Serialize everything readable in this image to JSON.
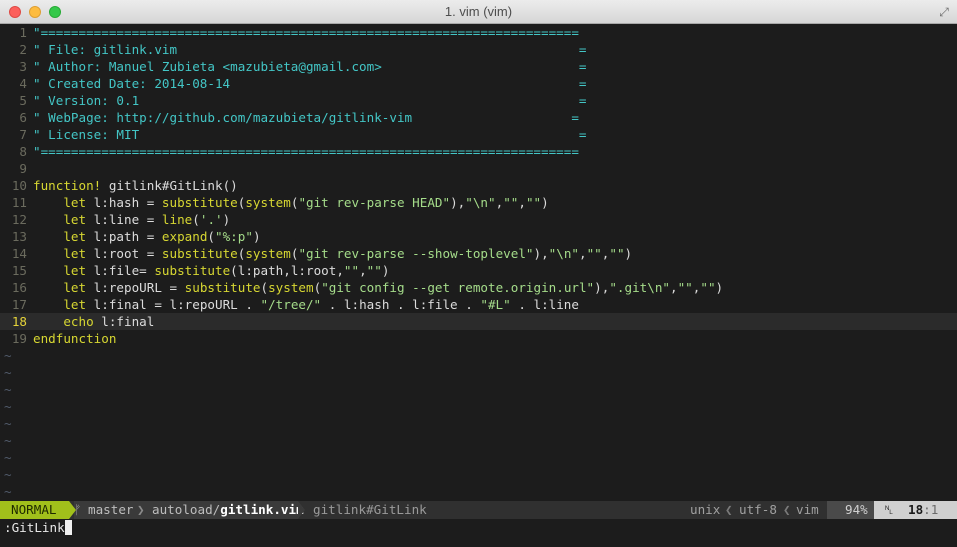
{
  "window": {
    "title": "1. vim (vim)"
  },
  "lines": [
    {
      "num": "1",
      "tokens": [
        {
          "t": "c",
          "v": "\"======================================================================="
        }
      ]
    },
    {
      "num": "2",
      "tokens": [
        {
          "t": "c",
          "v": "\" File: gitlink.vim                                                     ="
        }
      ]
    },
    {
      "num": "3",
      "tokens": [
        {
          "t": "c",
          "v": "\" Author: Manuel Zubieta <mazubieta@gmail.com>                          ="
        }
      ]
    },
    {
      "num": "4",
      "tokens": [
        {
          "t": "c",
          "v": "\" Created Date: 2014-08-14                                              ="
        }
      ]
    },
    {
      "num": "5",
      "tokens": [
        {
          "t": "c",
          "v": "\" Version: 0.1                                                          ="
        }
      ]
    },
    {
      "num": "6",
      "tokens": [
        {
          "t": "c",
          "v": "\" WebPage: http://github.com/mazubieta/gitlink-vim                     ="
        }
      ]
    },
    {
      "num": "7",
      "tokens": [
        {
          "t": "c",
          "v": "\" License: MIT                                                          ="
        }
      ]
    },
    {
      "num": "8",
      "tokens": [
        {
          "t": "c",
          "v": "\"======================================================================="
        }
      ]
    },
    {
      "num": "9",
      "tokens": []
    },
    {
      "num": "10",
      "tokens": [
        {
          "t": "k",
          "v": "function!"
        },
        {
          "t": "n",
          "v": " gitlink#GitLink()"
        }
      ]
    },
    {
      "num": "11",
      "tokens": [
        {
          "t": "n",
          "v": "    "
        },
        {
          "t": "k",
          "v": "let"
        },
        {
          "t": "n",
          "v": " l:hash = "
        },
        {
          "t": "k",
          "v": "substitute"
        },
        {
          "t": "n",
          "v": "("
        },
        {
          "t": "k",
          "v": "system"
        },
        {
          "t": "n",
          "v": "("
        },
        {
          "t": "s",
          "v": "\"git rev-parse HEAD\""
        },
        {
          "t": "n",
          "v": "),"
        },
        {
          "t": "s",
          "v": "\"\\n\""
        },
        {
          "t": "n",
          "v": ","
        },
        {
          "t": "s",
          "v": "\"\""
        },
        {
          "t": "n",
          "v": ","
        },
        {
          "t": "s",
          "v": "\"\""
        },
        {
          "t": "n",
          "v": ")"
        }
      ]
    },
    {
      "num": "12",
      "tokens": [
        {
          "t": "n",
          "v": "    "
        },
        {
          "t": "k",
          "v": "let"
        },
        {
          "t": "n",
          "v": " l:line = "
        },
        {
          "t": "k",
          "v": "line"
        },
        {
          "t": "n",
          "v": "("
        },
        {
          "t": "s",
          "v": "'.'"
        },
        {
          "t": "n",
          "v": ")"
        }
      ]
    },
    {
      "num": "13",
      "tokens": [
        {
          "t": "n",
          "v": "    "
        },
        {
          "t": "k",
          "v": "let"
        },
        {
          "t": "n",
          "v": " l:path = "
        },
        {
          "t": "k",
          "v": "expand"
        },
        {
          "t": "n",
          "v": "("
        },
        {
          "t": "s",
          "v": "\"%:p\""
        },
        {
          "t": "n",
          "v": ")"
        }
      ]
    },
    {
      "num": "14",
      "tokens": [
        {
          "t": "n",
          "v": "    "
        },
        {
          "t": "k",
          "v": "let"
        },
        {
          "t": "n",
          "v": " l:root = "
        },
        {
          "t": "k",
          "v": "substitute"
        },
        {
          "t": "n",
          "v": "("
        },
        {
          "t": "k",
          "v": "system"
        },
        {
          "t": "n",
          "v": "("
        },
        {
          "t": "s",
          "v": "\"git rev-parse --show-toplevel\""
        },
        {
          "t": "n",
          "v": "),"
        },
        {
          "t": "s",
          "v": "\"\\n\""
        },
        {
          "t": "n",
          "v": ","
        },
        {
          "t": "s",
          "v": "\"\""
        },
        {
          "t": "n",
          "v": ","
        },
        {
          "t": "s",
          "v": "\"\""
        },
        {
          "t": "n",
          "v": ")"
        }
      ]
    },
    {
      "num": "15",
      "tokens": [
        {
          "t": "n",
          "v": "    "
        },
        {
          "t": "k",
          "v": "let"
        },
        {
          "t": "n",
          "v": " l:file= "
        },
        {
          "t": "k",
          "v": "substitute"
        },
        {
          "t": "n",
          "v": "(l:path,l:root,"
        },
        {
          "t": "s",
          "v": "\"\""
        },
        {
          "t": "n",
          "v": ","
        },
        {
          "t": "s",
          "v": "\"\""
        },
        {
          "t": "n",
          "v": ")"
        }
      ]
    },
    {
      "num": "16",
      "tokens": [
        {
          "t": "n",
          "v": "    "
        },
        {
          "t": "k",
          "v": "let"
        },
        {
          "t": "n",
          "v": " l:repoURL = "
        },
        {
          "t": "k",
          "v": "substitute"
        },
        {
          "t": "n",
          "v": "("
        },
        {
          "t": "k",
          "v": "system"
        },
        {
          "t": "n",
          "v": "("
        },
        {
          "t": "s",
          "v": "\"git config --get remote.origin.url\""
        },
        {
          "t": "n",
          "v": "),"
        },
        {
          "t": "s",
          "v": "\".git\\n\""
        },
        {
          "t": "n",
          "v": ","
        },
        {
          "t": "s",
          "v": "\"\""
        },
        {
          "t": "n",
          "v": ","
        },
        {
          "t": "s",
          "v": "\"\""
        },
        {
          "t": "n",
          "v": ")"
        }
      ]
    },
    {
      "num": "17",
      "tokens": [
        {
          "t": "n",
          "v": "    "
        },
        {
          "t": "k",
          "v": "let"
        },
        {
          "t": "n",
          "v": " l:final = l:repoURL . "
        },
        {
          "t": "s",
          "v": "\"/tree/\""
        },
        {
          "t": "n",
          "v": " . l:hash . l:file . "
        },
        {
          "t": "s",
          "v": "\"#L\""
        },
        {
          "t": "n",
          "v": " . l:line"
        }
      ]
    },
    {
      "num": "18",
      "current": true,
      "tokens": [
        {
          "t": "n",
          "v": "    "
        },
        {
          "t": "k",
          "v": "echo"
        },
        {
          "t": "n",
          "v": " l:final"
        }
      ]
    },
    {
      "num": "19",
      "tokens": [
        {
          "t": "k",
          "v": "endfunction"
        }
      ]
    }
  ],
  "tildes": 9,
  "status": {
    "mode": "NORMAL",
    "branch_icon": "ᚠ",
    "branch": "master",
    "path_dir": "autoload/",
    "path_file": "gitlink.vim",
    "function": "gitlink#GitLink",
    "fileformat": "unix",
    "encoding": "utf-8",
    "filetype": "vim",
    "percent": "94%",
    "line": "18",
    "col": ":1"
  },
  "cmdline": ":GitLink"
}
